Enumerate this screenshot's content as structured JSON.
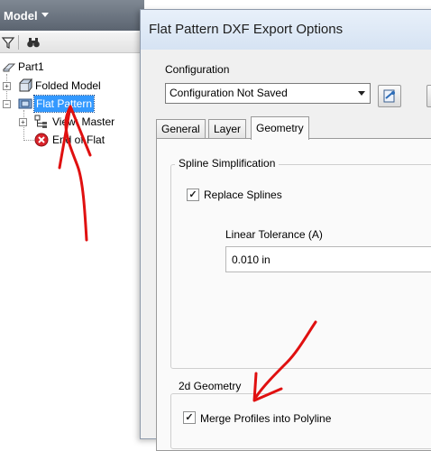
{
  "browser": {
    "title": "Model",
    "toolbar": {
      "filter_icon": "filter-icon",
      "search_icon": "binoculars-icon"
    },
    "tree": {
      "part": "Part1",
      "folded_model": "Folded Model",
      "flat_pattern": "Flat Pattern",
      "view": "View: Master",
      "end_of_flat": "End of Flat"
    }
  },
  "dialog": {
    "title": "Flat Pattern DXF Export Options",
    "configuration_label": "Configuration",
    "configuration_value": "Configuration Not Saved",
    "tabs": [
      {
        "label": "General"
      },
      {
        "label": "Layer"
      },
      {
        "label": "Geometry"
      }
    ],
    "active_tab": "Geometry",
    "spline_group": {
      "title": "Spline Simplification",
      "replace_splines": "Replace Splines",
      "replace_splines_checked": true,
      "linear_tolerance_label": "Linear Tolerance (A)",
      "linear_tolerance_value": "0.010 in"
    },
    "geometry_group": {
      "title": "2d Geometry",
      "merge_profiles": "Merge Profiles into Polyline",
      "merge_profiles_checked": true
    }
  },
  "colors": {
    "annotation": "#e01010",
    "selection": "#3399ff",
    "header": "#6b7480"
  }
}
